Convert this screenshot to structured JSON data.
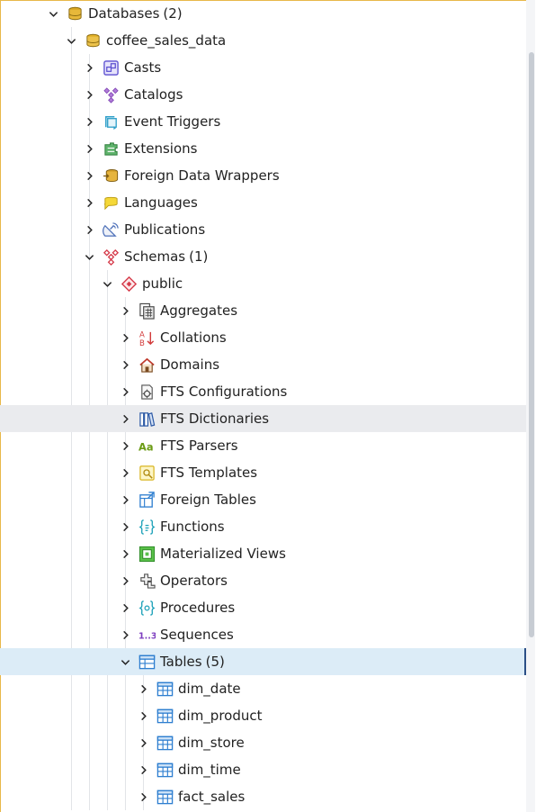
{
  "tree": {
    "rows": [
      {
        "id": "databases",
        "label": "Databases",
        "count": "(2)",
        "depth": 0,
        "expanded": true,
        "icon": "databases-icon",
        "state": ""
      },
      {
        "id": "coffee-sales-data",
        "label": "coffee_sales_data",
        "count": "",
        "depth": 1,
        "expanded": true,
        "icon": "database-icon",
        "state": ""
      },
      {
        "id": "casts",
        "label": "Casts",
        "count": "",
        "depth": 2,
        "expanded": false,
        "icon": "casts-icon",
        "state": ""
      },
      {
        "id": "catalogs",
        "label": "Catalogs",
        "count": "",
        "depth": 2,
        "expanded": false,
        "icon": "catalogs-icon",
        "state": ""
      },
      {
        "id": "event-triggers",
        "label": "Event Triggers",
        "count": "",
        "depth": 2,
        "expanded": false,
        "icon": "event-triggers-icon",
        "state": ""
      },
      {
        "id": "extensions",
        "label": "Extensions",
        "count": "",
        "depth": 2,
        "expanded": false,
        "icon": "extensions-icon",
        "state": ""
      },
      {
        "id": "foreign-data-wrappers",
        "label": "Foreign Data Wrappers",
        "count": "",
        "depth": 2,
        "expanded": false,
        "icon": "foreign-data-wrappers-icon",
        "state": ""
      },
      {
        "id": "languages",
        "label": "Languages",
        "count": "",
        "depth": 2,
        "expanded": false,
        "icon": "languages-icon",
        "state": ""
      },
      {
        "id": "publications",
        "label": "Publications",
        "count": "",
        "depth": 2,
        "expanded": false,
        "icon": "publications-icon",
        "state": ""
      },
      {
        "id": "schemas",
        "label": "Schemas",
        "count": "(1)",
        "depth": 2,
        "expanded": true,
        "icon": "schemas-icon",
        "state": ""
      },
      {
        "id": "public",
        "label": "public",
        "count": "",
        "depth": 3,
        "expanded": true,
        "icon": "schema-icon",
        "state": ""
      },
      {
        "id": "aggregates",
        "label": "Aggregates",
        "count": "",
        "depth": 4,
        "expanded": false,
        "icon": "aggregates-icon",
        "state": ""
      },
      {
        "id": "collations",
        "label": "Collations",
        "count": "",
        "depth": 4,
        "expanded": false,
        "icon": "collations-icon",
        "state": ""
      },
      {
        "id": "domains",
        "label": "Domains",
        "count": "",
        "depth": 4,
        "expanded": false,
        "icon": "domains-icon",
        "state": ""
      },
      {
        "id": "fts-configurations",
        "label": "FTS Configurations",
        "count": "",
        "depth": 4,
        "expanded": false,
        "icon": "fts-configurations-icon",
        "state": ""
      },
      {
        "id": "fts-dictionaries",
        "label": "FTS Dictionaries",
        "count": "",
        "depth": 4,
        "expanded": false,
        "icon": "fts-dictionaries-icon",
        "state": "hover"
      },
      {
        "id": "fts-parsers",
        "label": "FTS Parsers",
        "count": "",
        "depth": 4,
        "expanded": false,
        "icon": "fts-parsers-icon",
        "state": ""
      },
      {
        "id": "fts-templates",
        "label": "FTS Templates",
        "count": "",
        "depth": 4,
        "expanded": false,
        "icon": "fts-templates-icon",
        "state": ""
      },
      {
        "id": "foreign-tables",
        "label": "Foreign Tables",
        "count": "",
        "depth": 4,
        "expanded": false,
        "icon": "foreign-tables-icon",
        "state": ""
      },
      {
        "id": "functions",
        "label": "Functions",
        "count": "",
        "depth": 4,
        "expanded": false,
        "icon": "functions-icon",
        "state": ""
      },
      {
        "id": "materialized-views",
        "label": "Materialized Views",
        "count": "",
        "depth": 4,
        "expanded": false,
        "icon": "materialized-views-icon",
        "state": ""
      },
      {
        "id": "operators",
        "label": "Operators",
        "count": "",
        "depth": 4,
        "expanded": false,
        "icon": "operators-icon",
        "state": ""
      },
      {
        "id": "procedures",
        "label": "Procedures",
        "count": "",
        "depth": 4,
        "expanded": false,
        "icon": "procedures-icon",
        "state": ""
      },
      {
        "id": "sequences",
        "label": "Sequences",
        "count": "",
        "depth": 4,
        "expanded": false,
        "icon": "sequences-icon",
        "state": ""
      },
      {
        "id": "tables",
        "label": "Tables",
        "count": "(5)",
        "depth": 4,
        "expanded": true,
        "icon": "tables-icon",
        "state": "selected"
      },
      {
        "id": "dim-date",
        "label": "dim_date",
        "count": "",
        "depth": 5,
        "expanded": false,
        "icon": "table-icon",
        "state": ""
      },
      {
        "id": "dim-product",
        "label": "dim_product",
        "count": "",
        "depth": 5,
        "expanded": false,
        "icon": "table-icon",
        "state": ""
      },
      {
        "id": "dim-store",
        "label": "dim_store",
        "count": "",
        "depth": 5,
        "expanded": false,
        "icon": "table-icon",
        "state": ""
      },
      {
        "id": "dim-time",
        "label": "dim_time",
        "count": "",
        "depth": 5,
        "expanded": false,
        "icon": "table-icon",
        "state": ""
      },
      {
        "id": "fact-sales",
        "label": "fact_sales",
        "count": "",
        "depth": 5,
        "expanded": false,
        "icon": "table-icon",
        "state": ""
      }
    ]
  },
  "colors": {
    "frame_border": "#e8b84a",
    "hover_bg": "#eaebee",
    "selected_bg": "#dcecf7",
    "selected_edge": "#2b4f86",
    "text": "#222222"
  }
}
